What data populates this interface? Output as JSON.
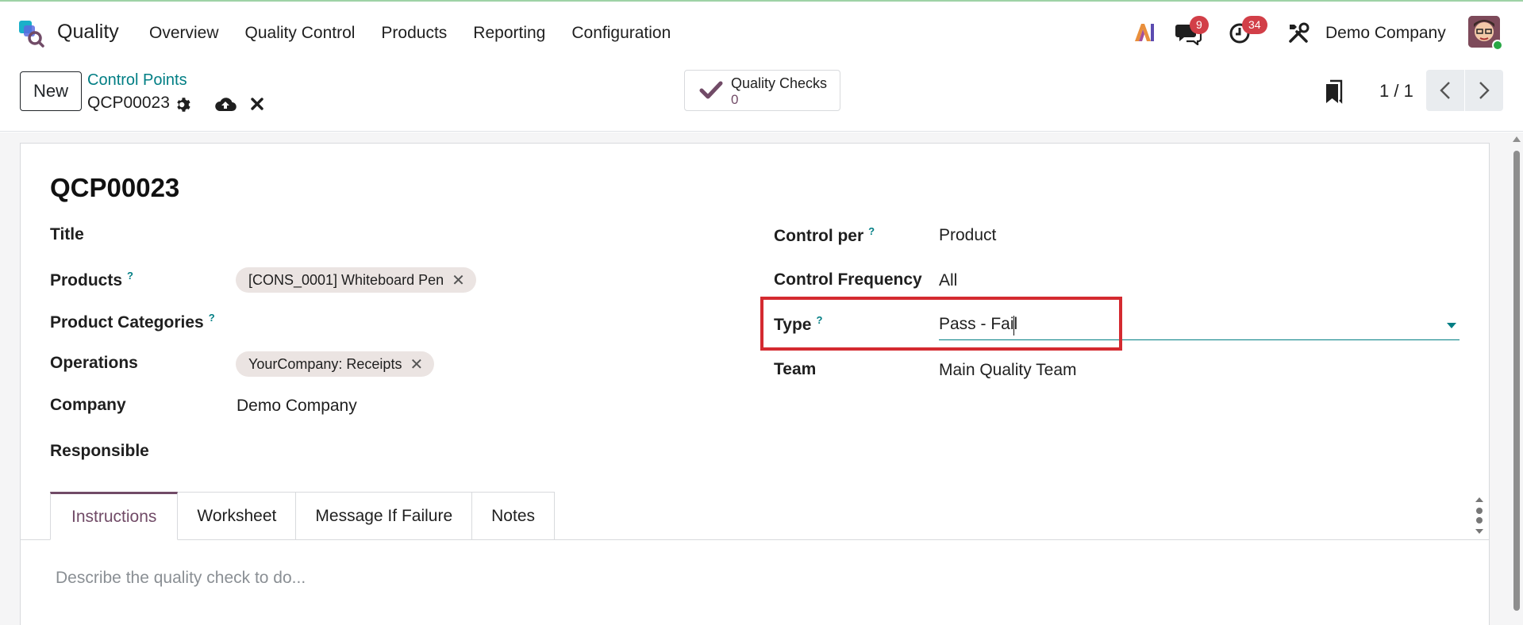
{
  "app": {
    "name": "Quality"
  },
  "menu": [
    "Overview",
    "Quality Control",
    "Products",
    "Reporting",
    "Configuration"
  ],
  "systray": {
    "ai_label": "AI",
    "messages_count": "9",
    "activities_count": "34",
    "company": "Demo Company"
  },
  "control_panel": {
    "new_label": "New",
    "breadcrumb": "Control Points",
    "record": "QCP00023",
    "smart_button": {
      "label": "Quality Checks",
      "value": "0"
    },
    "pager": "1 / 1"
  },
  "form": {
    "title": "QCP00023",
    "left": {
      "title_label": "Title",
      "products_label": "Products",
      "products_tag": "[CONS_0001] Whiteboard Pen",
      "categories_label": "Product Categories",
      "operations_label": "Operations",
      "operations_tag": "YourCompany: Receipts",
      "company_label": "Company",
      "company_value": "Demo Company",
      "responsible_label": "Responsible"
    },
    "right": {
      "control_per_label": "Control per",
      "control_per_value": "Product",
      "frequency_label": "Control Frequency",
      "frequency_value": "All",
      "type_label": "Type",
      "type_value": "Pass - Fail",
      "team_label": "Team",
      "team_value": "Main Quality Team"
    },
    "help_mark": "?",
    "tabs": [
      "Instructions",
      "Worksheet",
      "Message If Failure",
      "Notes"
    ],
    "instructions_placeholder": "Describe the quality check to do..."
  },
  "colors": {
    "primary": "#714b67",
    "link": "#017e84",
    "highlight": "#d42a30",
    "badge": "#d23f48"
  }
}
